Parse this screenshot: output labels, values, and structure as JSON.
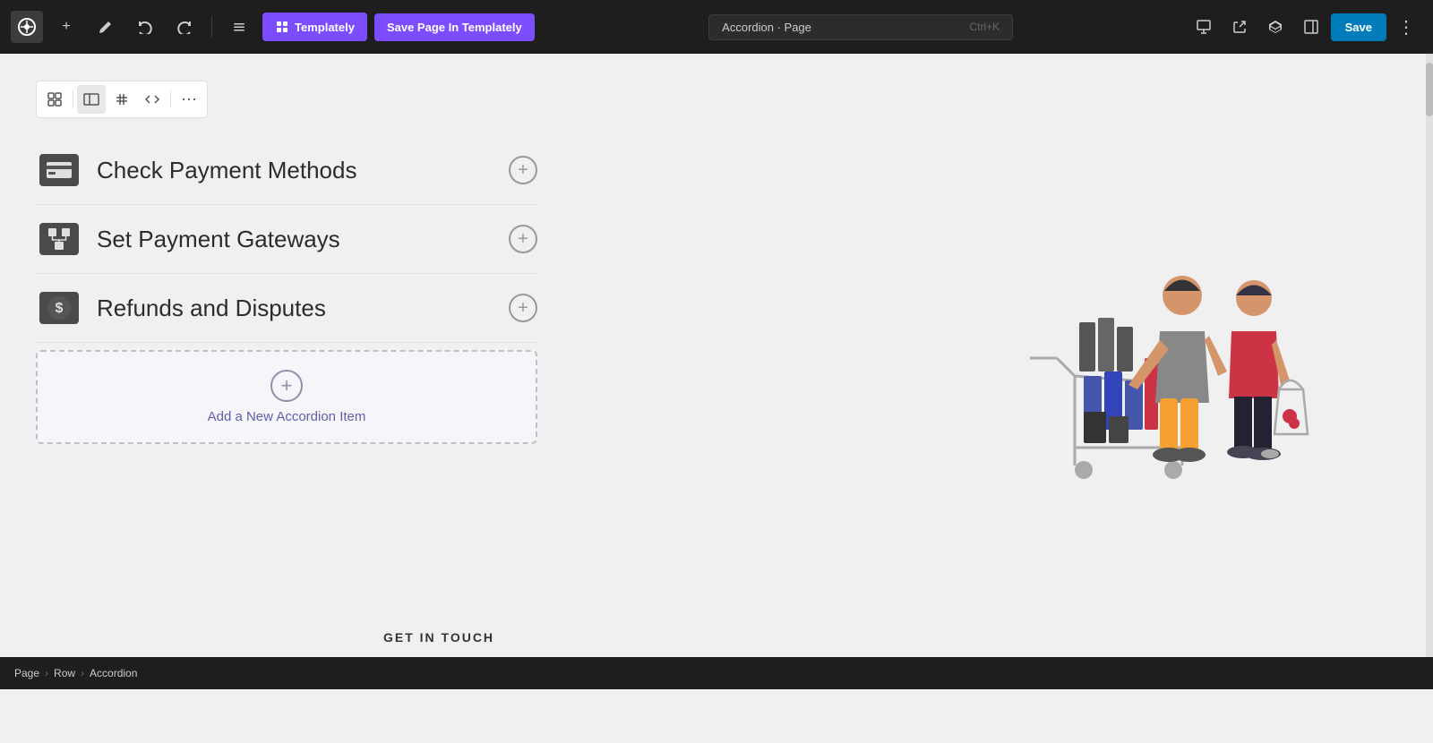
{
  "toolbar": {
    "wp_logo": "W",
    "add_label": "+",
    "edit_label": "✎",
    "undo_label": "↩",
    "redo_label": "↪",
    "more_label": "≡",
    "templately_label": "Templately",
    "save_templately_label": "Save Page In Templately",
    "search_text": "Accordion · Page",
    "search_shortcut": "Ctrl+K",
    "save_label": "Save",
    "device_desktop_label": "🖥",
    "open_new_label": "⬡",
    "blocks_icon_label": "B",
    "panel_label": "⬜",
    "more_options_label": "⋮"
  },
  "block_toolbar": {
    "btn1": "◫",
    "btn2": "⊞",
    "btn3": "⋮⋮",
    "btn4": "<>",
    "btn5": "⋯"
  },
  "accordion": {
    "items": [
      {
        "id": "item-1",
        "title": "Check Payment Methods",
        "icon_type": "card"
      },
      {
        "id": "item-2",
        "title": "Set Payment Gateways",
        "icon_type": "gateway"
      },
      {
        "id": "item-3",
        "title": "Refunds and Disputes",
        "icon_type": "refund"
      }
    ],
    "add_new_label": "Add a New Accordion Item"
  },
  "footer_text": "GET IN TOUCH",
  "breadcrumb": {
    "page": "Page",
    "row": "Row",
    "accordion": "Accordion"
  }
}
